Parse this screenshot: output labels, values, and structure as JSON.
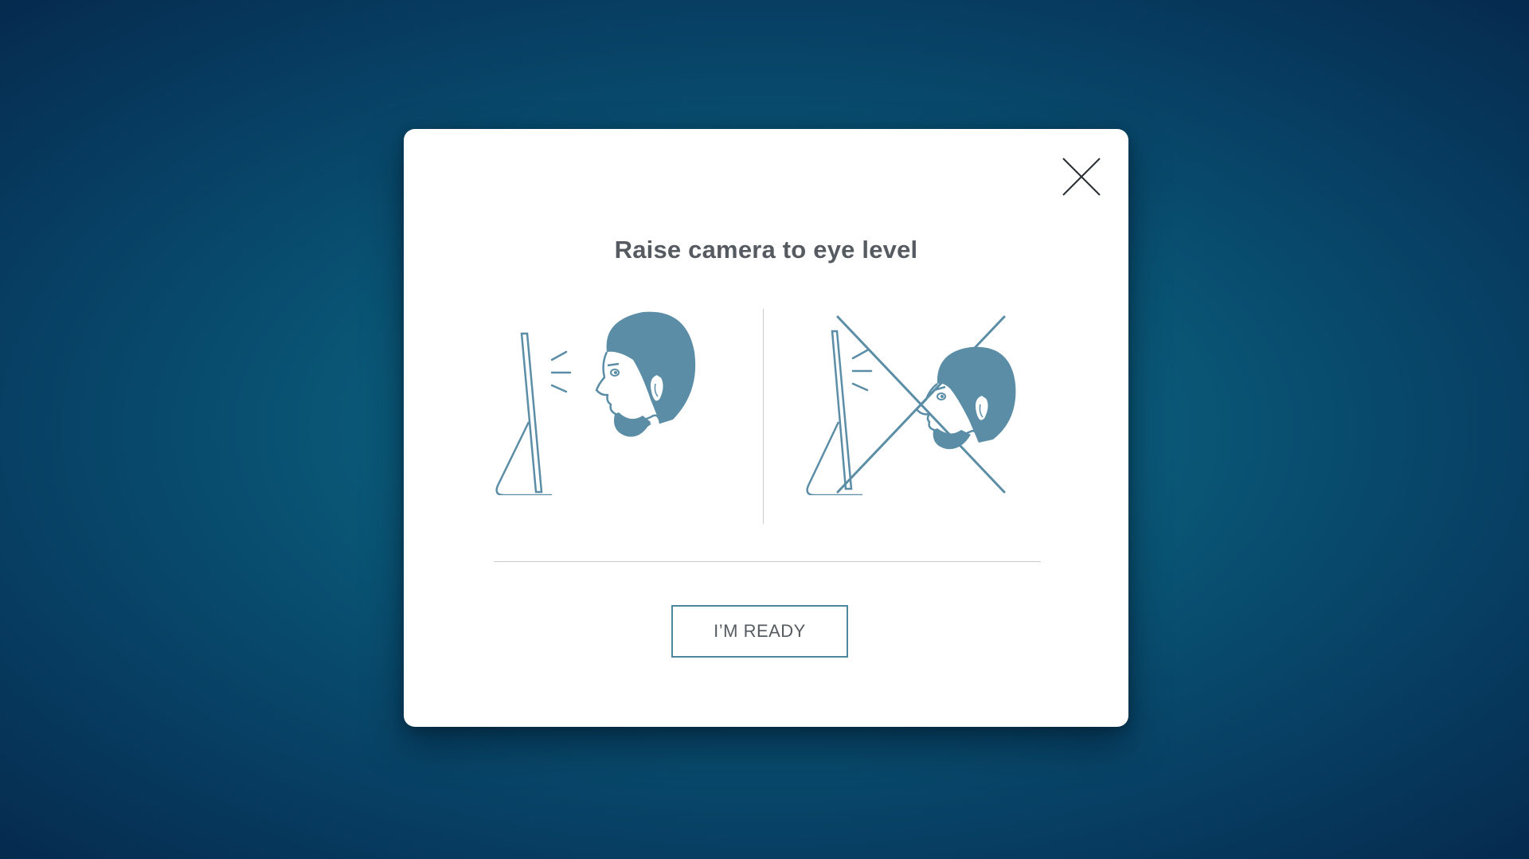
{
  "modal": {
    "title": "Raise camera to eye level",
    "ready_button_label": "I’M READY",
    "close_icon": "close-icon"
  },
  "illustrations": {
    "correct": "correct-posture-illustration",
    "incorrect": "incorrect-posture-illustration",
    "cross_mark": "cross-out-icon"
  },
  "colors": {
    "accent": "#4d869f",
    "illustration_fill": "#5b8ea6",
    "title_text": "#555b60",
    "background_center": "#0d6a88",
    "background_edge": "#052a4e"
  }
}
